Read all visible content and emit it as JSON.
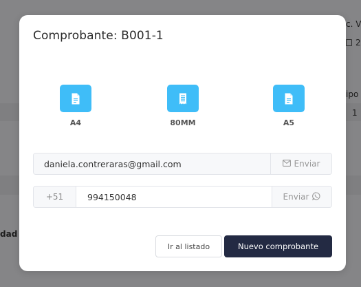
{
  "background": {
    "header_fragment": "c. V",
    "date_fragment": "2",
    "column_fragment": "ipo",
    "cell_fragment": "1",
    "row_label_fragment": "dad"
  },
  "modal": {
    "title": "Comprobante: B001-1",
    "formats": [
      {
        "label": "A4",
        "icon": "document-icon"
      },
      {
        "label": "80MM",
        "icon": "receipt-icon"
      },
      {
        "label": "A5",
        "icon": "document-icon"
      }
    ],
    "email": {
      "value": "daniela.contreraras@gmail.com",
      "send_label": "Enviar",
      "send_icon": "mail-icon"
    },
    "whatsapp": {
      "prefix": "+51",
      "value": "994150048",
      "send_label": "Enviar",
      "send_icon": "whatsapp-icon"
    },
    "buttons": {
      "list_label": "Ir al listado",
      "new_label": "Nuevo comprobante"
    }
  },
  "colors": {
    "format_icon": "#3fbdf8",
    "primary_button": "#232a43",
    "overlay": "rgba(0,0,0,0.45)"
  }
}
